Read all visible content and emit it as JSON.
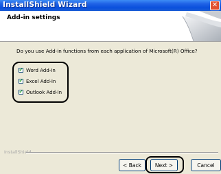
{
  "window": {
    "title": "InstallShield Wizard"
  },
  "header": {
    "title": "Add-in settings"
  },
  "question": "Do you use Add-in functions from each application of Microsoft(R) Office?",
  "options": [
    {
      "label": "Word Add-In",
      "checked": true
    },
    {
      "label": "Excel Add-In",
      "checked": true
    },
    {
      "label": "Outlook Add-In",
      "checked": true
    }
  ],
  "footer": {
    "brand": "InstallShield"
  },
  "buttons": {
    "back": "< Back",
    "next": "Next >",
    "cancel": "Cancel"
  },
  "colors": {
    "titlebar": "#0a4fdc",
    "dialog_bg": "#ece9d8",
    "close_button": "#e2502f"
  },
  "icons": {
    "close": "close-icon",
    "check": "check-icon"
  }
}
